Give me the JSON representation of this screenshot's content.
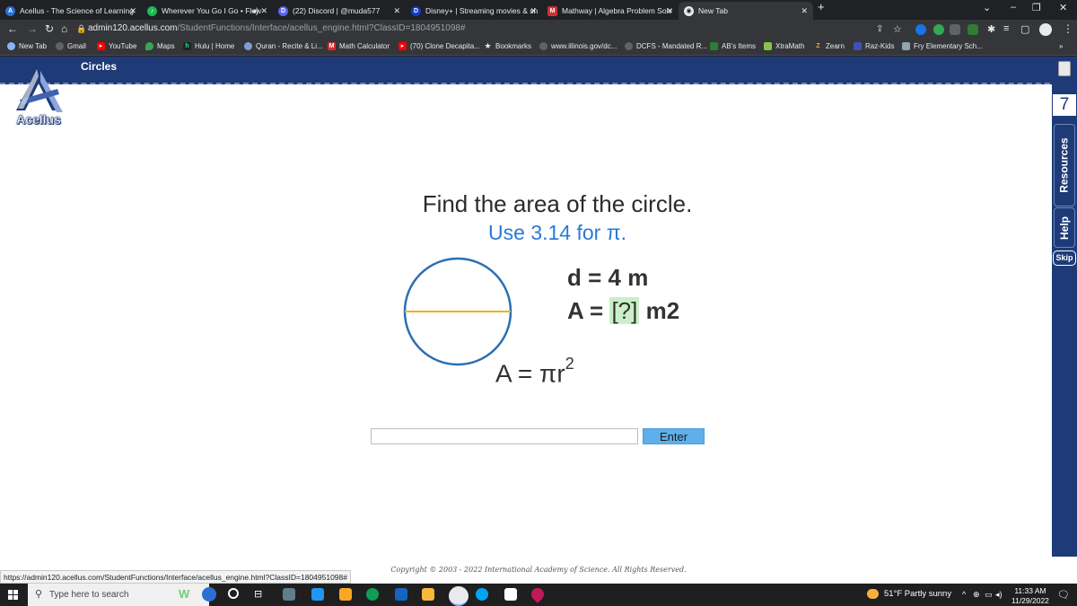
{
  "browser": {
    "tabs": [
      {
        "title": "Acellus - The Science of Learning",
        "color": "#2a6fd6",
        "icon": "acellus-icon",
        "active": false
      },
      {
        "title": "Wherever You Go I Go • Flow",
        "color": "#1db954",
        "icon": "spotify-icon",
        "active": false
      },
      {
        "title": "(22) Discord | @muda577",
        "color": "#5865f2",
        "icon": "discord-icon",
        "active": false
      },
      {
        "title": "Disney+ | Streaming movies & sh",
        "color": "#113ccf",
        "icon": "disney-icon",
        "active": false
      },
      {
        "title": "Mathway | Algebra Problem Solv",
        "color": "#d32f2f",
        "icon": "mathway-icon",
        "active": false
      },
      {
        "title": "New Tab",
        "color": "#e8eaed",
        "icon": "chrome-icon",
        "active": true
      }
    ],
    "new_tab_label": "+",
    "url": {
      "host": "admin120.acellus.com",
      "path": "/StudentFunctions/Interface/acellus_engine.html?ClassID=1804951098#"
    },
    "bookmarks": [
      {
        "label": "New Tab",
        "color": "#8ab4f8"
      },
      {
        "label": "Gmail",
        "color": "#5f6368"
      },
      {
        "label": "YouTube",
        "color": "#ff0000"
      },
      {
        "label": "Maps",
        "color": "#34a853"
      },
      {
        "label": "Hulu | Home",
        "color": "#1ce783"
      },
      {
        "label": "Quran - Recite & Li...",
        "color": "#7e9cd8"
      },
      {
        "label": "Math Calculator",
        "color": "#d32f2f"
      },
      {
        "label": "(70) Clone Decapita...",
        "color": "#ff0000"
      },
      {
        "label": "Bookmarks",
        "color": "#e8eaed"
      },
      {
        "label": "www.illinois.gov/dc...",
        "color": "#5f6368"
      },
      {
        "label": "DCFS - Mandated R...",
        "color": "#5f6368"
      },
      {
        "label": "AB's Items",
        "color": "#2e7d32"
      },
      {
        "label": "XtraMath",
        "color": "#8bc34a"
      },
      {
        "label": "Zearn",
        "color": "#f9a825"
      },
      {
        "label": "Raz-Kids",
        "color": "#3f51b5"
      },
      {
        "label": "Fry Elementary Sch...",
        "color": "#90a4ae"
      }
    ]
  },
  "app": {
    "lesson_title": "Circles",
    "logo_text": "Acellus",
    "progress_number": "7",
    "rail": {
      "resources": "Resources",
      "help": "Help",
      "skip": "Skip"
    },
    "question": {
      "line1": "Find the area of the circle.",
      "line2": "Use 3.14 for π.",
      "diameter": "d = 4 m",
      "area_prefix": "A = ",
      "area_blank": "[?]",
      "area_suffix": " m2",
      "formula_base": "A = πr",
      "formula_exp": "2"
    },
    "answer_value": "",
    "enter_label": "Enter",
    "copyright": "Copyright © 2003 - 2022 International Academy of Science. All Rights Reserved.",
    "colors": {
      "header": "#1e3b78",
      "accent_blue": "#2a7ad6",
      "diameter_line": "#f0b21a",
      "circle_stroke": "#2a6fb3",
      "blank_fill": "#c9f0c9"
    }
  },
  "status_url": "https://admin120.acellus.com/StudentFunctions/Interface/acellus_engine.html?ClassID=1804951098#",
  "taskbar": {
    "search_placeholder": "Type here to search",
    "weather": "51°F  Partly sunny",
    "time": "11:33 AM",
    "date": "11/29/2022"
  }
}
